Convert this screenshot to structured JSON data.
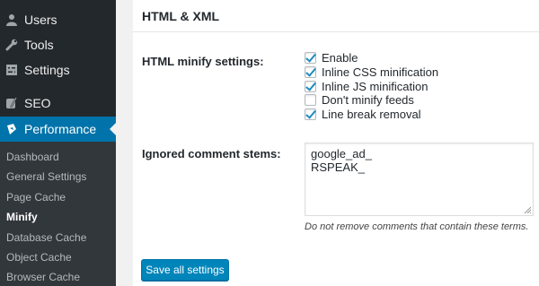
{
  "sidebar": {
    "items": [
      {
        "label": "Users",
        "icon": "users-icon"
      },
      {
        "label": "Tools",
        "icon": "wrench-icon"
      },
      {
        "label": "Settings",
        "icon": "settings-icon"
      },
      {
        "label": "SEO",
        "icon": "seo-icon"
      },
      {
        "label": "Performance",
        "icon": "performance-icon"
      }
    ],
    "submenu": [
      "Dashboard",
      "General Settings",
      "Page Cache",
      "Minify",
      "Database Cache",
      "Object Cache",
      "Browser Cache"
    ],
    "current": "Minify"
  },
  "panel": {
    "title": "HTML & XML",
    "minify_label": "HTML minify settings:",
    "options": [
      {
        "label": "Enable",
        "checked": true
      },
      {
        "label": "Inline CSS minification",
        "checked": true
      },
      {
        "label": "Inline JS minification",
        "checked": true
      },
      {
        "label": "Don't minify feeds",
        "checked": false
      },
      {
        "label": "Line break removal",
        "checked": true
      }
    ],
    "ignored_label": "Ignored comment stems:",
    "ignored_lines": [
      "google_ad_",
      "RSPEAK_"
    ],
    "hint": "Do not remove comments that contain these terms.",
    "save_button": "Save all settings"
  },
  "colors": {
    "accent": "#0073aa",
    "sidebar": "#23282d",
    "submenu": "#32373c",
    "button": "#0085ba"
  }
}
